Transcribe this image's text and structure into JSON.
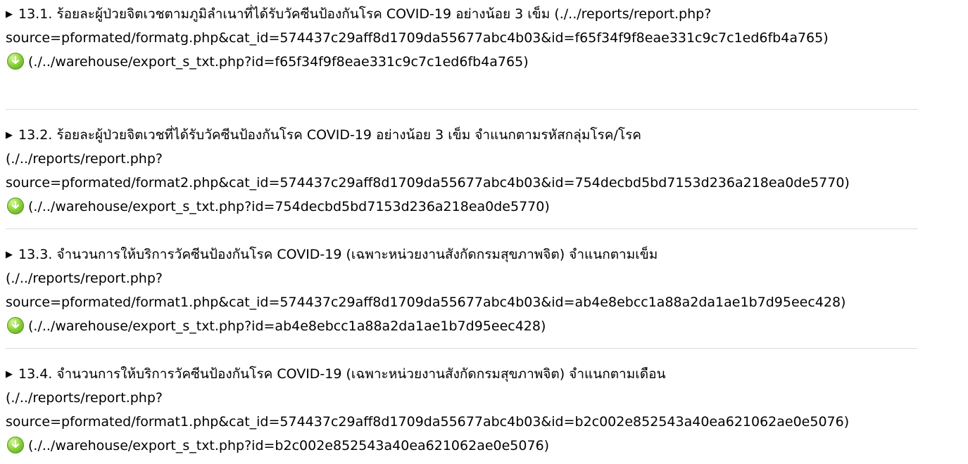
{
  "entries": [
    {
      "title_line": "13.1. ร้อยละผู้ป่วยจิตเวชตามภูมิลำเนาที่ได้รับวัคซีนป้องกันโรค COVID-19 อย่างน้อย 3 เข็ม (./../reports/report.php?",
      "source_line": "source=pformated/formatg.php&cat_id=574437c29aff8d1709da55677abc4b03&id=f65f34f9f8eae331c9c7c1ed6fb4a765)",
      "export_text": "(./../warehouse/export_s_txt.php?id=f65f34f9f8eae331c9c7c1ed6fb4a765)"
    },
    {
      "title_line": "13.2. ร้อยละผู้ป่วยจิตเวชที่ได้รับวัคซีนป้องกันโรค COVID-19 อย่างน้อย 3 เข็ม จำแนกตามรหัสกลุ่มโรค/โรค",
      "path_line": "(./../reports/report.php?",
      "source_line": "source=pformated/format2.php&cat_id=574437c29aff8d1709da55677abc4b03&id=754decbd5bd7153d236a218ea0de5770)",
      "export_text": "(./../warehouse/export_s_txt.php?id=754decbd5bd7153d236a218ea0de5770)"
    },
    {
      "title_line": "13.3. จำนวนการให้บริการวัคซีนป้องกันโรค COVID-19 (เฉพาะหน่วยงานสังกัดกรมสุขภาพจิต) จำแนกตามเข็ม",
      "path_line": "(./../reports/report.php?",
      "source_line": "source=pformated/format1.php&cat_id=574437c29aff8d1709da55677abc4b03&id=ab4e8ebcc1a88a2da1ae1b7d95eec428)",
      "export_text": "(./../warehouse/export_s_txt.php?id=ab4e8ebcc1a88a2da1ae1b7d95eec428)"
    },
    {
      "title_line": "13.4. จำนวนการให้บริการวัคซีนป้องกันโรค COVID-19 (เฉพาะหน่วยงานสังกัดกรมสุขภาพจิต) จำแนกตามเดือน",
      "path_line": "(./../reports/report.php?",
      "source_line": "source=pformated/format1.php&cat_id=574437c29aff8d1709da55677abc4b03&id=b2c002e852543a40ea621062ae0e5076)",
      "export_text": "(./../warehouse/export_s_txt.php?id=b2c002e852543a40ea621062ae0e5076)"
    }
  ],
  "icons": {
    "caret": "caret-right-icon",
    "export": "green-download-circle-icon"
  },
  "colors": {
    "text": "#000000",
    "divider": "#dddddd",
    "export_icon": "#8fd33a"
  }
}
